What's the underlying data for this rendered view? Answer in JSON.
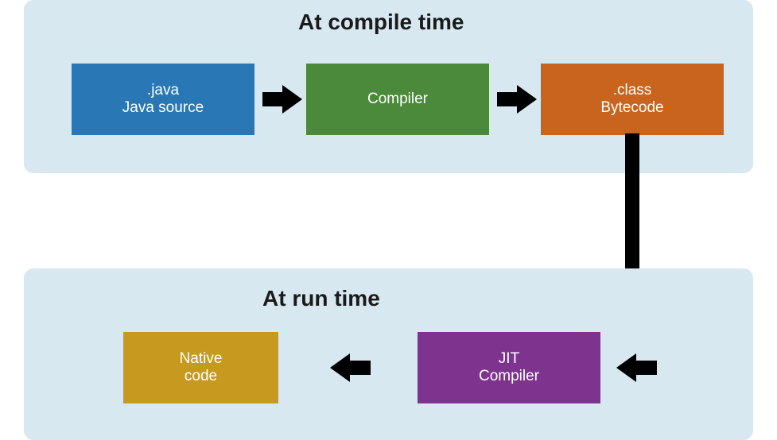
{
  "compile_panel": {
    "title": "At compile time",
    "boxes": {
      "java_source": {
        "line1": ".java",
        "line2": "Java source",
        "color": "#2978b5"
      },
      "compiler": {
        "label": "Compiler",
        "color": "#4a8a3a"
      },
      "bytecode": {
        "line1": ".class",
        "line2": "Bytecode",
        "color": "#c8641e"
      }
    }
  },
  "run_panel": {
    "title": "At run time",
    "boxes": {
      "jit_compiler": {
        "line1": "JIT",
        "line2": "Compiler",
        "color": "#7e348f"
      },
      "native_code": {
        "line1": "Native",
        "line2": "code",
        "color": "#c79a1f"
      }
    }
  }
}
